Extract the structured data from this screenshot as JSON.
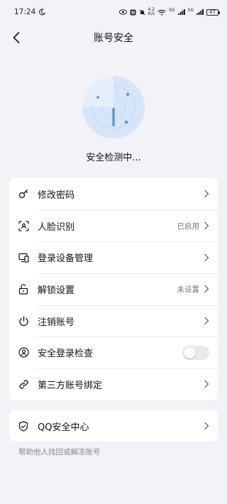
{
  "status_bar": {
    "time": "17:24",
    "net_speed_top": "4.2",
    "net_speed_bottom": "K/s",
    "sim1": "5G",
    "sim2": "5G",
    "battery": "47"
  },
  "header": {
    "title": "账号安全"
  },
  "scan": {
    "status_text": "安全检测中..."
  },
  "settings": [
    {
      "label": "修改密码",
      "icon": "key-icon",
      "value": ""
    },
    {
      "label": "人脸识别",
      "icon": "face-scan-icon",
      "value": "已启用"
    },
    {
      "label": "登录设备管理",
      "icon": "devices-icon",
      "value": ""
    },
    {
      "label": "解锁设置",
      "icon": "unlock-icon",
      "value": "未设置"
    },
    {
      "label": "注销账号",
      "icon": "power-icon",
      "value": ""
    },
    {
      "label": "安全登录检查",
      "icon": "user-shield-icon",
      "toggle": false
    },
    {
      "label": "第三方账号绑定",
      "icon": "link-icon",
      "value": ""
    }
  ],
  "qq_center": {
    "label": "QQ安全中心",
    "icon": "shield-check-icon"
  },
  "footer": {
    "hint": "帮助他人找回或解冻账号"
  },
  "colors": {
    "accent": "#4A90E2",
    "radar_fill": "#D6E6F8",
    "background": "#F2F2F7"
  }
}
